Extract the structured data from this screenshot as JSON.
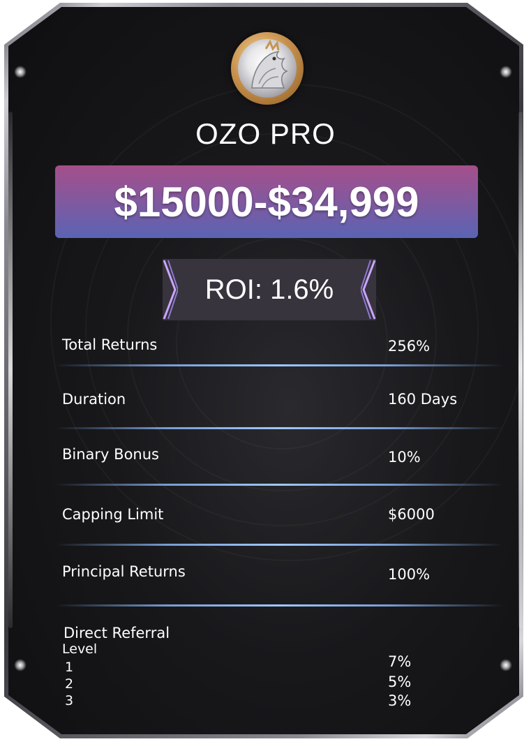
{
  "plan": {
    "name": "OZO PRO",
    "price_range": "$15000-$34,999",
    "roi": "ROI: 1.6%"
  },
  "details": [
    {
      "label": "Total Returns",
      "value": "256%"
    },
    {
      "label": "Duration",
      "value": "160 Days"
    },
    {
      "label": "Binary Bonus",
      "value": "10%"
    },
    {
      "label": "Capping Limit",
      "value": "$6000"
    },
    {
      "label": "Principal Returns",
      "value": "100%"
    }
  ],
  "referral": {
    "heading": "Direct Referral",
    "level_label": "Level",
    "levels": [
      {
        "level": "1",
        "value": "7%"
      },
      {
        "level": "2",
        "value": "5%"
      },
      {
        "level": "3",
        "value": "3%"
      }
    ]
  },
  "colors": {
    "banner_top": "#a54f8a",
    "banner_bottom": "#5a64b4",
    "card_bg": "#18181b",
    "divider": "#a0c8ff",
    "roi_box": "#38343d"
  },
  "icons": {
    "logo": "eagle-emblem-icon",
    "roi_left": "chevron-right-icon",
    "roi_right": "chevron-left-icon"
  }
}
